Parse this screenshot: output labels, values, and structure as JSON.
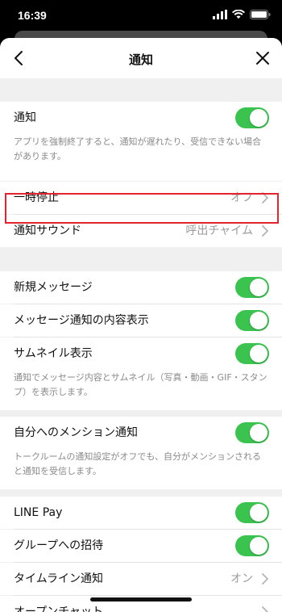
{
  "status_bar": {
    "time": "16:39"
  },
  "nav": {
    "title": "通知"
  },
  "sections": {
    "notification": {
      "label": "通知",
      "hint": "アプリを強制終了すると、通知が遅れたり、受信できない場合があります。"
    },
    "pause": {
      "label": "一時停止",
      "value": "オフ"
    },
    "sound": {
      "label": "通知サウンド",
      "value": "呼出チャイム"
    },
    "new_message": {
      "label": "新規メッセージ"
    },
    "message_content": {
      "label": "メッセージ通知の内容表示"
    },
    "thumbnail": {
      "label": "サムネイル表示",
      "hint": "通知でメッセージ内容とサムネイル（写真・動画・GIF・スタンプ）を表示します。"
    },
    "mention": {
      "label": "自分へのメンション通知",
      "hint": "トークルームの通知設定がオフでも、自分がメンションされると通知を受信します。"
    },
    "line_pay": {
      "label": "LINE Pay"
    },
    "group_invite": {
      "label": "グループへの招待"
    },
    "timeline": {
      "label": "タイムライン通知",
      "value": "オン"
    },
    "openchat": {
      "label": "オープンチャット"
    }
  },
  "colors": {
    "toggle_on": "#3ac34f",
    "highlight": "#e4242d"
  },
  "icons": {
    "back": "chevron-left-icon",
    "close": "close-icon",
    "row_chevron": "chevron-right-icon"
  }
}
